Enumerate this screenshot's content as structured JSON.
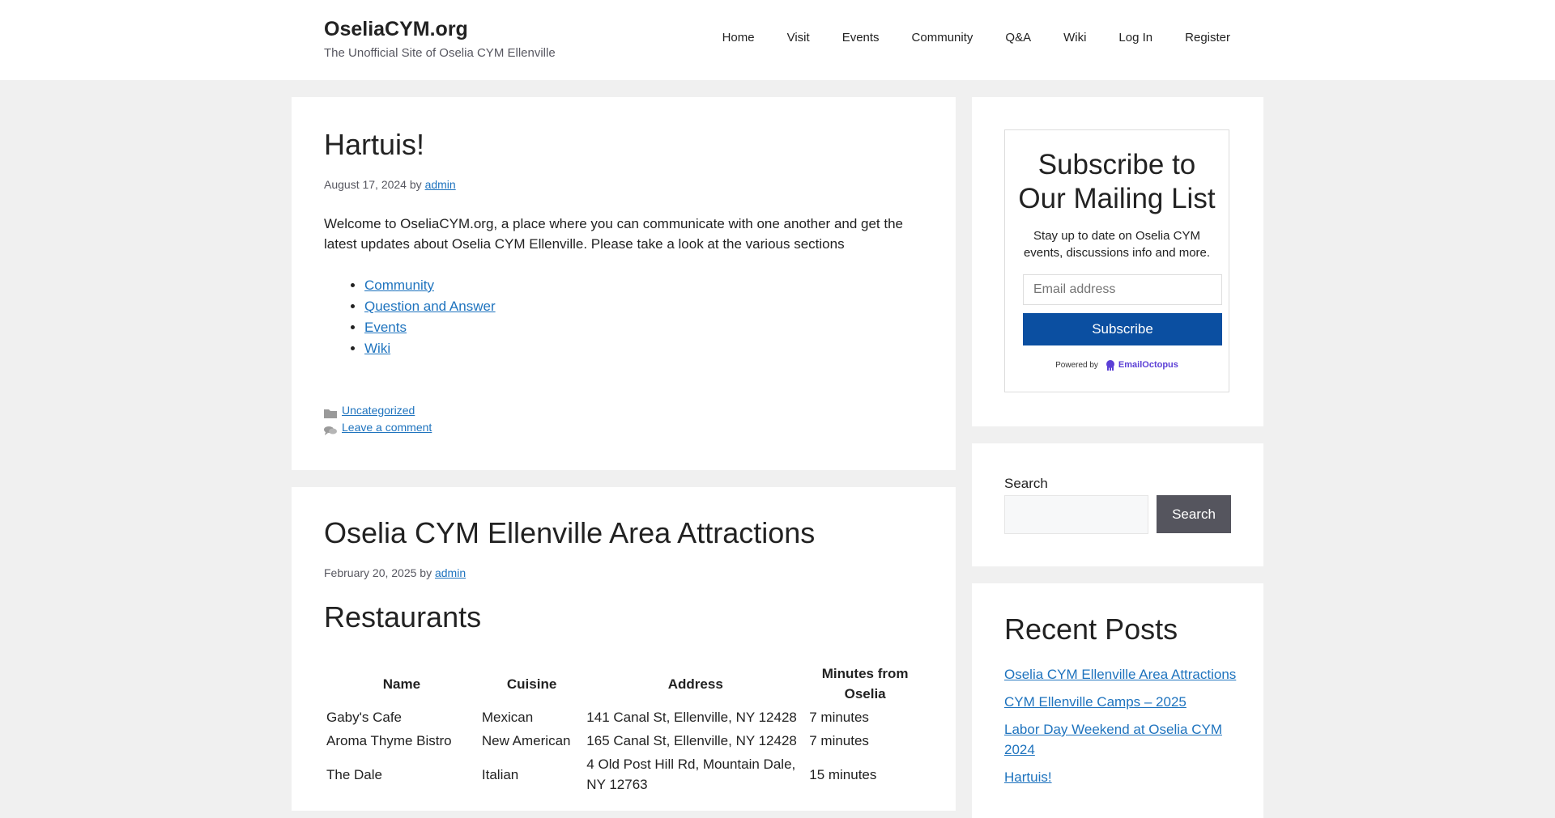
{
  "header": {
    "site_title": "OseliaCYM.org",
    "tagline": "The Unofficial Site of Oselia CYM Ellenville",
    "nav": [
      "Home",
      "Visit",
      "Events",
      "Community",
      "Q&A",
      "Wiki",
      "Log In",
      "Register"
    ]
  },
  "post1": {
    "title": "Hartuis!",
    "date": "August 17, 2024",
    "by": "by",
    "author": "admin",
    "body": "Welcome to OseliaCYM.org, a place where you can communicate with one another and get the latest updates about Oselia CYM Ellenville. Please take a look at the various sections",
    "links": [
      "Community",
      "Question and Answer",
      "Events",
      "Wiki"
    ],
    "category": "Uncategorized",
    "comment_link": "Leave a comment"
  },
  "post2": {
    "title": "Oselia CYM Ellenville Area Attractions",
    "date": "February 20, 2025",
    "by": "by",
    "author": "admin",
    "section_heading": "Restaurants",
    "table": {
      "headers": [
        "Name",
        "Cuisine",
        "Address",
        "Minutes from Oselia"
      ],
      "rows": [
        [
          "Gaby's Cafe",
          "Mexican",
          "141 Canal St, Ellenville, NY 12428",
          "7 minutes"
        ],
        [
          "Aroma Thyme Bistro",
          "New American",
          "165 Canal St, Ellenville, NY 12428",
          "7 minutes"
        ],
        [
          "The Dale",
          "Italian",
          "4 Old Post Hill Rd, Mountain Dale, NY 12763",
          "15 minutes"
        ]
      ]
    }
  },
  "sidebar": {
    "subscribe": {
      "title": "Subscribe to Our Mailing List",
      "description": "Stay up to date on Oselia CYM events, discussions info and more.",
      "email_placeholder": "Email address",
      "button": "Subscribe",
      "powered_by": "Powered by",
      "provider": "EmailOctopus"
    },
    "search": {
      "label": "Search",
      "button": "Search"
    },
    "recent": {
      "title": "Recent Posts",
      "items": [
        "Oselia CYM Ellenville Area Attractions",
        "CYM Ellenville Camps – 2025",
        "Labor Day Weekend at Oselia CYM 2024",
        "Hartuis!"
      ]
    }
  },
  "colors": {
    "link": "#1e73be",
    "subscribe_button": "#0b4fa1",
    "search_button": "#55555e",
    "page_background": "#f0f0f0"
  }
}
